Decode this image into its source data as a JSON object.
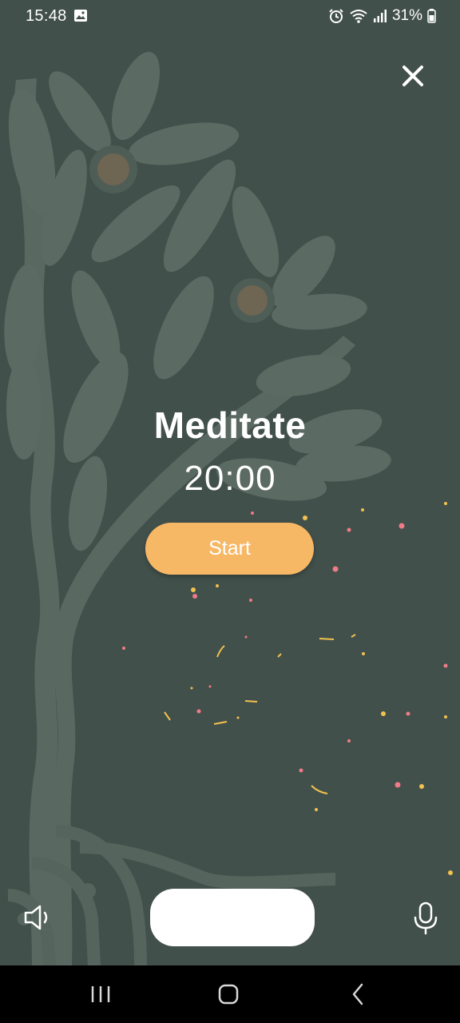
{
  "status_bar": {
    "time": "15:48",
    "battery_percent": "31%",
    "icons": [
      "gallery-icon",
      "alarm-icon",
      "wifi-icon",
      "signal-icon",
      "battery-icon"
    ]
  },
  "meditation": {
    "title": "Meditate",
    "timer": "20:00",
    "start_label": "Start"
  },
  "controls": {
    "close_icon": "close-icon",
    "volume_icon": "speaker-icon",
    "mic_icon": "microphone-icon"
  },
  "nav_bar": {
    "buttons": [
      "recent-apps-icon",
      "home-icon",
      "back-icon"
    ]
  },
  "colors": {
    "background": "#42504b",
    "tree_art": "#5d6a64",
    "accent": "#f7b866",
    "confetti_yellow": "#f2c14e",
    "confetti_pink": "#f07b86"
  }
}
